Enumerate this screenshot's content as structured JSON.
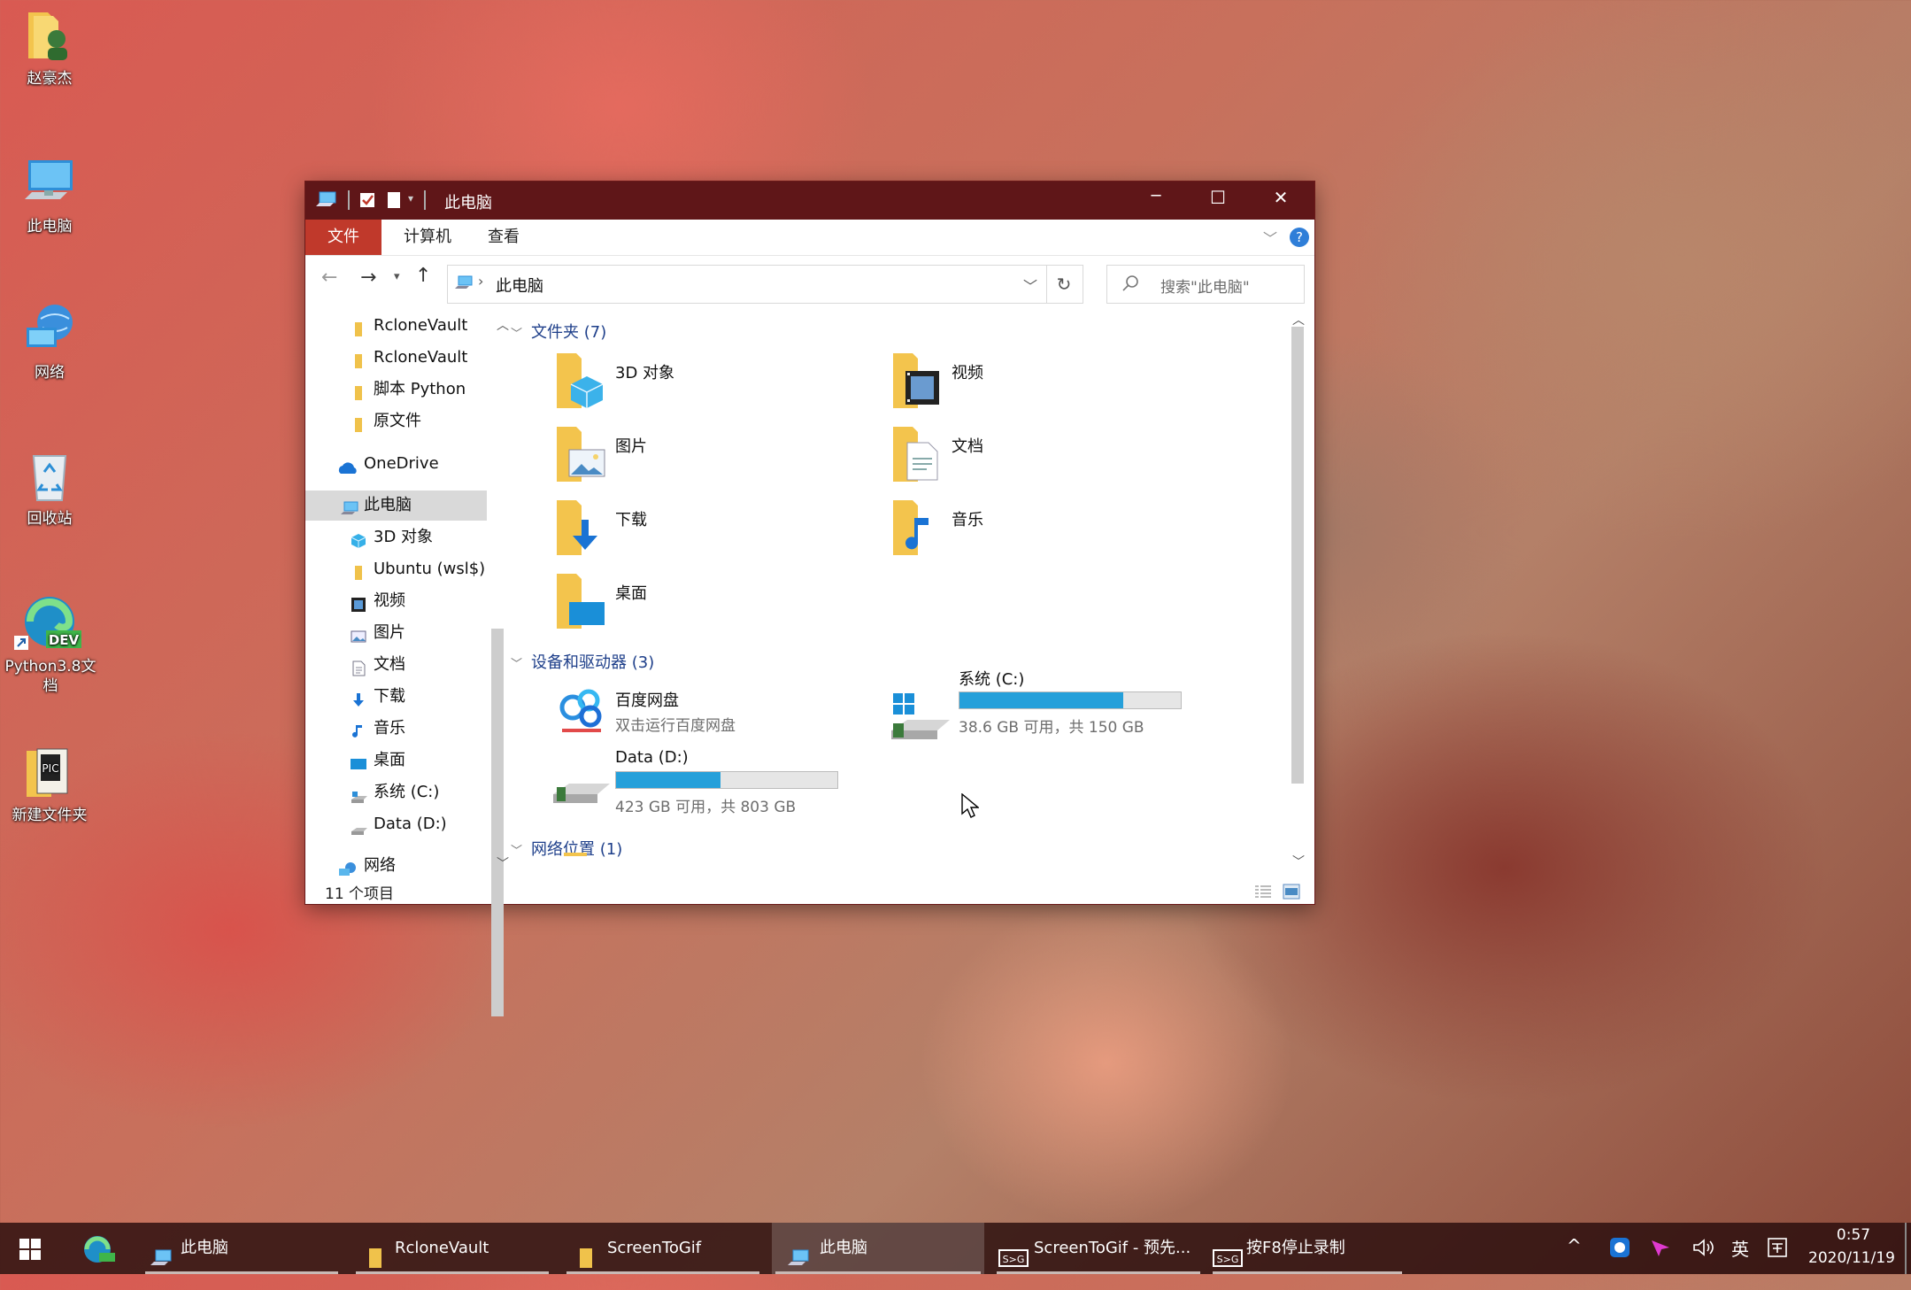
{
  "desktop": {
    "icons": [
      {
        "label": "赵豪杰"
      },
      {
        "label": "此电脑"
      },
      {
        "label": "网络"
      },
      {
        "label": "回收站"
      },
      {
        "label": "Python3.8文档",
        "badge": "DEV"
      },
      {
        "label": "新建文件夹"
      }
    ]
  },
  "window": {
    "title": "此电脑",
    "controls": {
      "minimize": "─",
      "maximize": "☐",
      "close": "✕"
    },
    "ribbon": {
      "tabs": [
        "文件",
        "计算机",
        "查看"
      ],
      "help": "?"
    },
    "address": {
      "path_root": "›",
      "path": "此电脑",
      "refresh": "↻"
    },
    "search": {
      "placeholder": "搜索\"此电脑\""
    },
    "nav_pane": [
      {
        "label": "RcloneVault",
        "icon": "folder-icon"
      },
      {
        "label": "RcloneVault",
        "icon": "folder-icon"
      },
      {
        "label": "脚本 Python",
        "icon": "folder-icon"
      },
      {
        "label": "原文件",
        "icon": "folder-icon"
      },
      {
        "label": "OneDrive",
        "icon": "cloud-icon"
      },
      {
        "label": "此电脑",
        "icon": "computer-icon",
        "selected": true
      },
      {
        "label": "3D 对象",
        "icon": "cube-icon"
      },
      {
        "label": "Ubuntu (wsl$)",
        "icon": "folder-icon"
      },
      {
        "label": "视频",
        "icon": "film-icon"
      },
      {
        "label": "图片",
        "icon": "picture-icon"
      },
      {
        "label": "文档",
        "icon": "document-icon"
      },
      {
        "label": "下载",
        "icon": "download-icon"
      },
      {
        "label": "音乐",
        "icon": "music-icon"
      },
      {
        "label": "桌面",
        "icon": "desktop-icon"
      },
      {
        "label": "系统 (C:)",
        "icon": "drive-icon"
      },
      {
        "label": "Data (D:)",
        "icon": "drive-icon"
      },
      {
        "label": "网络",
        "icon": "network-icon"
      }
    ],
    "sections": {
      "folders": {
        "title": "文件夹 (7)"
      },
      "devices": {
        "title": "设备和驱动器 (3)"
      },
      "network": {
        "title": "网络位置 (1)"
      }
    },
    "folders": [
      {
        "label": "3D 对象",
        "icon": "cube-icon"
      },
      {
        "label": "视频",
        "icon": "film-icon"
      },
      {
        "label": "图片",
        "icon": "picture-icon"
      },
      {
        "label": "文档",
        "icon": "document-icon"
      },
      {
        "label": "下载",
        "icon": "download-icon"
      },
      {
        "label": "音乐",
        "icon": "music-icon"
      },
      {
        "label": "桌面",
        "icon": "desktop-icon"
      }
    ],
    "drives": [
      {
        "name": "百度网盘",
        "info": "双击运行百度网盘",
        "icon": "baidu-netdisk-icon"
      },
      {
        "name": "系统 (C:)",
        "info": "38.6 GB 可用，共 150 GB",
        "used_fraction": 0.74
      },
      {
        "name": "Data (D:)",
        "info": "423 GB 可用，共 803 GB",
        "used_fraction": 0.47
      }
    ],
    "status": {
      "count": "11 个项目"
    }
  },
  "taskbar": {
    "items": [
      {
        "label": "此电脑",
        "active": false
      },
      {
        "label": "RcloneVault",
        "active": false
      },
      {
        "label": "ScreenToGif",
        "active": false
      },
      {
        "label": "此电脑",
        "active": true
      },
      {
        "label": "ScreenToGif - 预先...",
        "active": false
      },
      {
        "label": "按F8停止录制",
        "active": false
      }
    ],
    "tray": {
      "caret": "^",
      "ime": "英",
      "time": "0:57",
      "date": "2020/11/19"
    }
  },
  "colors": {
    "title_bar": "#5f1618",
    "accent": "#c0392b",
    "drive_fill": "#26a0da",
    "link": "#1e3f8a"
  }
}
